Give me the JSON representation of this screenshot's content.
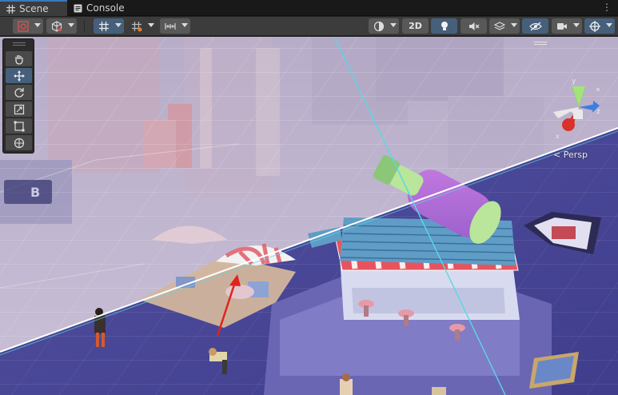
{
  "tabs": [
    {
      "label": "Scene",
      "icon": "grid-icon",
      "active": true
    },
    {
      "label": "Console",
      "icon": "console-icon",
      "active": false
    }
  ],
  "toolbar": {
    "toggle_2d_label": "2D"
  },
  "scene": {
    "camera_label": "< Persp",
    "gizmo_axes": {
      "y": "y",
      "z": "z",
      "x": "x"
    }
  },
  "tools": [
    "hand-tool",
    "move-tool",
    "rotate-tool",
    "scale-tool",
    "rect-tool",
    "transform-tool"
  ],
  "colors": {
    "accent": "#46607c",
    "axis_x": "#d9312b",
    "axis_y": "#7fd13b",
    "axis_z": "#3d7ee0",
    "selection_line": "#58d8e6",
    "arrow": "#e0241e"
  }
}
